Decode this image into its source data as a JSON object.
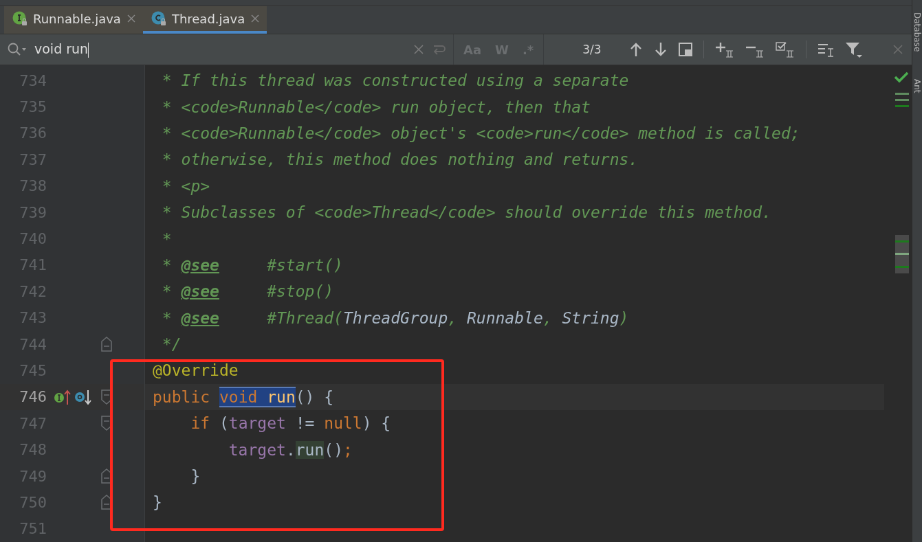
{
  "tabs": [
    {
      "label": "Runnable.java",
      "kind": "interface",
      "selected": false
    },
    {
      "label": "Thread.java",
      "kind": "class",
      "selected": true
    }
  ],
  "search": {
    "value": "void run",
    "match_count": "3/3",
    "options": [
      {
        "label": "Aa",
        "disabled": true
      },
      {
        "label": "W",
        "disabled": true
      },
      {
        "label": ".*",
        "disabled": true
      }
    ]
  },
  "side_panel": {
    "items": [
      "Database",
      "Ant"
    ]
  },
  "lines": [
    {
      "number": "734",
      "current": false,
      "tokens": [
        {
          "text": " * If this thread was constructed using a separate",
          "kind": "comment"
        }
      ]
    },
    {
      "number": "735",
      "current": false,
      "tokens": [
        {
          "text": " * <code>Runnable</code> run object, then that",
          "kind": "comment"
        }
      ]
    },
    {
      "number": "736",
      "current": false,
      "tokens": [
        {
          "text": " * <code>Runnable</code> object's <code>run</code> method is called;",
          "kind": "comment"
        }
      ]
    },
    {
      "number": "737",
      "current": false,
      "tokens": [
        {
          "text": " * otherwise, this method does nothing and returns.",
          "kind": "comment"
        }
      ]
    },
    {
      "number": "738",
      "current": false,
      "tokens": [
        {
          "text": " * <p>",
          "kind": "comment"
        }
      ]
    },
    {
      "number": "739",
      "current": false,
      "tokens": [
        {
          "text": " * Subclasses of <code>Thread</code> should override this method.",
          "kind": "comment"
        }
      ]
    },
    {
      "number": "740",
      "current": false,
      "tokens": [
        {
          "text": " *",
          "kind": "comment"
        }
      ]
    },
    {
      "number": "741",
      "current": false,
      "tokens": [
        {
          "text": " * ",
          "kind": "comment"
        },
        {
          "text": "@see",
          "kind": "doctag"
        },
        {
          "text": "     #start()",
          "kind": "comment"
        }
      ]
    },
    {
      "number": "742",
      "current": false,
      "tokens": [
        {
          "text": " * ",
          "kind": "comment"
        },
        {
          "text": "@see",
          "kind": "doctag"
        },
        {
          "text": "     #stop()",
          "kind": "comment"
        }
      ]
    },
    {
      "number": "743",
      "current": false,
      "tokens": [
        {
          "text": " * ",
          "kind": "comment"
        },
        {
          "text": "@see",
          "kind": "doctag"
        },
        {
          "text": "     #Thread(",
          "kind": "comment"
        },
        {
          "text": "ThreadGroup",
          "kind": "docref"
        },
        {
          "text": ", ",
          "kind": "comment"
        },
        {
          "text": "Runnable",
          "kind": "docref"
        },
        {
          "text": ", ",
          "kind": "comment"
        },
        {
          "text": "String",
          "kind": "docref"
        },
        {
          "text": ")",
          "kind": "comment"
        }
      ]
    },
    {
      "number": "744",
      "current": false,
      "fold": {
        "kind": "end"
      },
      "tokens": [
        {
          "text": " */",
          "kind": "comment"
        }
      ]
    },
    {
      "number": "745",
      "current": false,
      "tokens": [
        {
          "text": "@Override",
          "kind": "annotation"
        }
      ]
    },
    {
      "number": "746",
      "current": true,
      "fold": {
        "kind": "start"
      },
      "markers": [
        {
          "kind": "implements"
        },
        {
          "kind": "overridden"
        }
      ],
      "tokens": [
        {
          "text": "public ",
          "kind": "keyword"
        },
        {
          "text": "void ",
          "kind": "keyword",
          "highlight": {
            "kind": "search"
          }
        },
        {
          "text": "run",
          "kind": "method",
          "highlight": {
            "kind": "search"
          }
        },
        {
          "text": "() {",
          "kind": "plain"
        }
      ]
    },
    {
      "number": "747",
      "current": false,
      "fold": {
        "kind": "start"
      },
      "tokens": [
        {
          "text": "    if",
          "kind": "keyword"
        },
        {
          "text": " (",
          "kind": "plain"
        },
        {
          "text": "target",
          "kind": "field"
        },
        {
          "text": " != ",
          "kind": "plain"
        },
        {
          "text": "null",
          "kind": "keyword"
        },
        {
          "text": ") {",
          "kind": "plain"
        }
      ]
    },
    {
      "number": "748",
      "current": false,
      "tokens": [
        {
          "text": "        target",
          "kind": "field"
        },
        {
          "text": ".",
          "kind": "plain"
        },
        {
          "text": "run",
          "kind": "plain",
          "highlight": {
            "kind": "usage"
          }
        },
        {
          "text": "()",
          "kind": "plain"
        },
        {
          "text": ";",
          "kind": "keyword"
        }
      ]
    },
    {
      "number": "749",
      "current": false,
      "fold": {
        "kind": "end"
      },
      "tokens": [
        {
          "text": "    }",
          "kind": "plain"
        }
      ]
    },
    {
      "number": "750",
      "current": false,
      "fold": {
        "kind": "end"
      },
      "tokens": [
        {
          "text": "}",
          "kind": "plain"
        }
      ]
    },
    {
      "number": "751",
      "current": false
    }
  ]
}
